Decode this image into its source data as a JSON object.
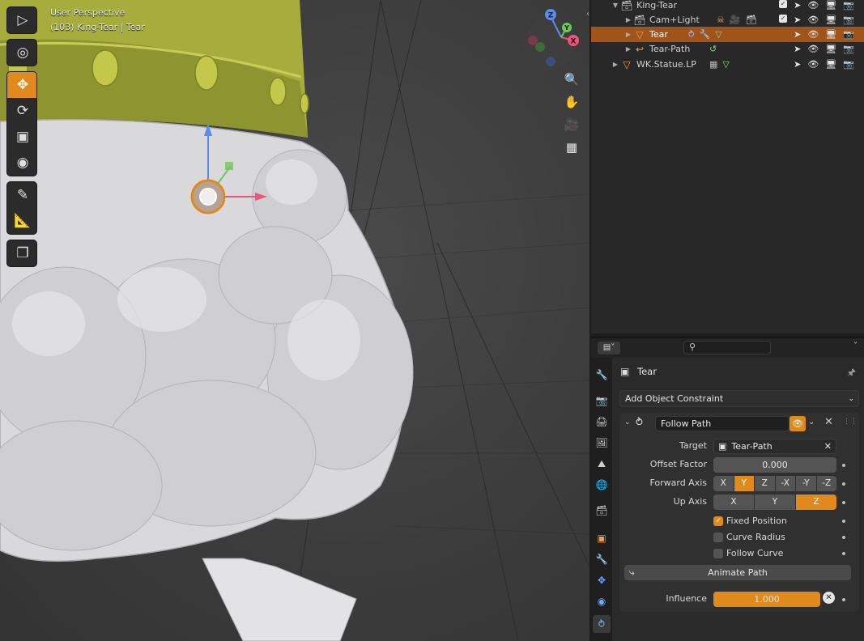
{
  "viewport": {
    "perspective": "User Perspective",
    "context": "(103) King-Tear | Tear",
    "tools": [
      "select-box",
      "cursor",
      "move",
      "rotate",
      "scale",
      "transform",
      "annotate",
      "measure",
      "add-cube"
    ],
    "active_tool": "move",
    "gizmo_axes": [
      "Z",
      "X",
      "Y"
    ],
    "nav_buttons": [
      "zoom",
      "pan",
      "camera",
      "grid"
    ]
  },
  "outliner": {
    "rows": [
      {
        "name": "King-Tear",
        "icon": "collection-icon"
      },
      {
        "name": "Cam+Light",
        "icon": "collection-icon"
      },
      {
        "name": "Tear",
        "icon": "mesh-icon",
        "selected": true
      },
      {
        "name": "Tear-Path",
        "icon": "curve-icon"
      },
      {
        "name": "WK.Statue.LP",
        "icon": "mesh-icon"
      }
    ]
  },
  "properties": {
    "search_placeholder": "",
    "object_name": "Tear",
    "add_constraint": "Add Object Constraint",
    "constraint_name": "Follow Path",
    "target_label": "Target",
    "target_value": "Tear-Path",
    "offset_factor_label": "Offset Factor",
    "offset_factor_value": "0.000",
    "forward_axis_label": "Forward Axis",
    "forward_axis_options": [
      "X",
      "Y",
      "Z",
      "-X",
      "-Y",
      "-Z"
    ],
    "forward_axis_selected": "Y",
    "up_axis_label": "Up Axis",
    "up_axis_options": [
      "X",
      "Y",
      "Z"
    ],
    "up_axis_selected": "Z",
    "fixed_position_label": "Fixed Position",
    "fixed_position": true,
    "curve_radius_label": "Curve Radius",
    "curve_radius": false,
    "follow_curve_label": "Follow Curve",
    "follow_curve": false,
    "animate_path_label": "Animate Path",
    "influence_label": "Influence",
    "influence_value": "1.000",
    "influence_fraction": 1.0
  },
  "colors": {
    "accent": "#e08a1e",
    "selected_row": "#a0541a",
    "panel": "#2a2a2a",
    "field": "#545454"
  }
}
